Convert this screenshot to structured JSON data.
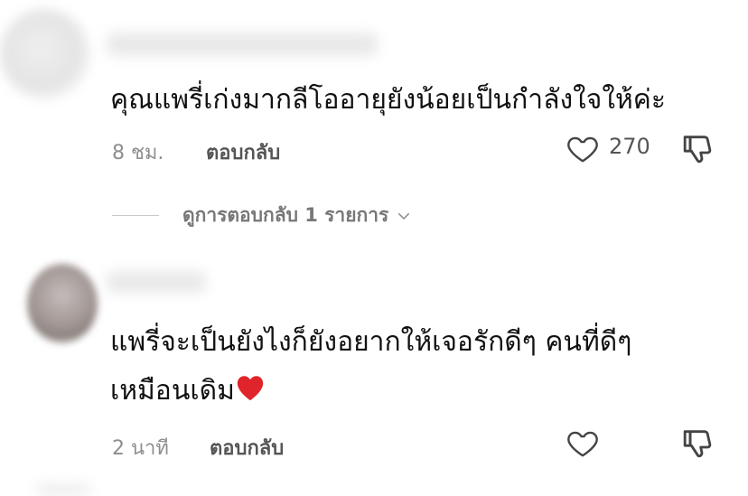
{
  "comments": [
    {
      "text_lines": [
        "คุณแพรี่เก่งมากลีโออายุยังน้อยเป็นกำลังใจให้ค่ะ"
      ],
      "time": "8 ชม.",
      "reply_label": "ตอบกลับ",
      "like_count": "270"
    },
    {
      "text_lines": [
        "แพรี่จะเป็นยังไงก็ยังอยากให้เจอรักดีๆ คนที่ดีๆ",
        "เหมือนเดิม"
      ],
      "time": "2 นาที",
      "reply_label": "ตอบกลับ",
      "like_count": ""
    }
  ],
  "view_replies": {
    "label": "ดูการตอบกลับ 1 รายการ"
  },
  "icons": {
    "like": "heart-outline-icon",
    "dislike": "thumbs-down-icon",
    "expand": "chevron-down-icon",
    "emoji": "red-heart-emoji"
  },
  "colors": {
    "text": "#111111",
    "muted": "#8e8e8e",
    "emoji_heart": "#e0242b"
  }
}
